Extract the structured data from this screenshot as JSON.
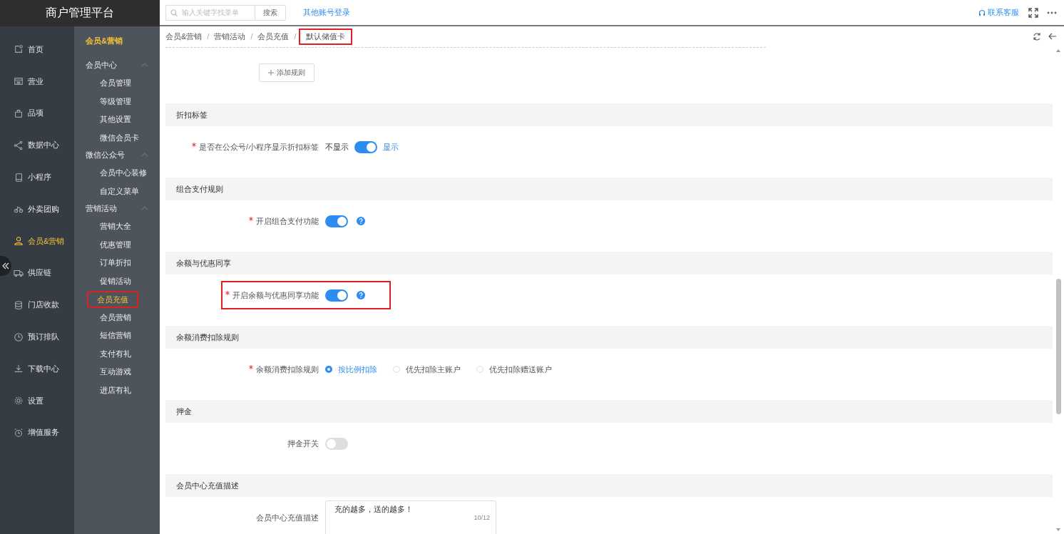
{
  "app_title": "商户管理平台",
  "topbar": {
    "search": {
      "placeholder": "输入关键字找菜单"
    },
    "search_button": "搜索",
    "other_login": "其他账号登录",
    "support": "联系客服"
  },
  "nav": [
    {
      "label": "首页",
      "selected": false
    },
    {
      "label": "营业",
      "selected": false
    },
    {
      "label": "品项",
      "selected": false
    },
    {
      "label": "数据中心",
      "selected": false
    },
    {
      "label": "小程序",
      "selected": false
    },
    {
      "label": "外卖团购",
      "selected": false
    },
    {
      "label": "会员&营销",
      "selected": true
    },
    {
      "label": "供应链",
      "selected": false
    },
    {
      "label": "门店收款",
      "selected": false
    },
    {
      "label": "预订排队",
      "selected": false
    },
    {
      "label": "下载中心",
      "selected": false
    },
    {
      "label": "设置",
      "selected": false
    },
    {
      "label": "增值服务",
      "selected": false
    }
  ],
  "subnav": {
    "title": "会员&营销",
    "groups": [
      {
        "label": "会员中心",
        "expanded": true,
        "items": [
          {
            "label": "会员管理",
            "selected": false,
            "highlighted": false
          },
          {
            "label": "等级管理",
            "selected": false,
            "highlighted": false
          },
          {
            "label": "其他设置",
            "selected": false,
            "highlighted": false
          },
          {
            "label": "微信会员卡",
            "selected": false,
            "highlighted": false
          }
        ]
      },
      {
        "label": "微信公众号",
        "expanded": true,
        "items": [
          {
            "label": "会员中心装修",
            "selected": false,
            "highlighted": false
          },
          {
            "label": "自定义菜单",
            "selected": false,
            "highlighted": false
          }
        ]
      },
      {
        "label": "营销活动",
        "expanded": true,
        "items": [
          {
            "label": "营销大全",
            "selected": false,
            "highlighted": false
          },
          {
            "label": "优惠管理",
            "selected": false,
            "highlighted": false
          },
          {
            "label": "订单折扣",
            "selected": false,
            "highlighted": false
          },
          {
            "label": "促销活动",
            "selected": false,
            "highlighted": false
          },
          {
            "label": "会员充值",
            "selected": true,
            "highlighted": true
          },
          {
            "label": "会员营销",
            "selected": false,
            "highlighted": false
          },
          {
            "label": "短信营销",
            "selected": false,
            "highlighted": false
          },
          {
            "label": "支付有礼",
            "selected": false,
            "highlighted": false
          },
          {
            "label": "互动游戏",
            "selected": false,
            "highlighted": false
          },
          {
            "label": "进店有礼",
            "selected": false,
            "highlighted": false
          }
        ]
      }
    ]
  },
  "breadcrumb_separator": "/",
  "breadcrumb": [
    {
      "label": "会员&营销",
      "highlighted": false
    },
    {
      "label": "营销活动",
      "highlighted": false
    },
    {
      "label": "会员充值",
      "highlighted": false
    },
    {
      "label": "默认储值卡",
      "highlighted": true
    }
  ],
  "add_rule_button": "添加规则",
  "sections": [
    {
      "title": "折扣标签",
      "row": {
        "kind": "toggle_options",
        "label": "是否在公众号/小程序显示折扣标签",
        "required": true,
        "off_text": "不显示",
        "on_text": "显示",
        "on": true,
        "highlighted": false
      }
    },
    {
      "title": "组合支付规则",
      "row": {
        "kind": "toggle",
        "label": "开启组合支付功能",
        "required": true,
        "on": true,
        "help": true,
        "highlighted": false
      }
    },
    {
      "title": "余额与优惠同享",
      "row": {
        "kind": "toggle",
        "label": "开启余额与优惠同享功能",
        "required": true,
        "on": true,
        "help": true,
        "highlighted": true
      }
    },
    {
      "title": "余额消费扣除规则",
      "row": {
        "kind": "radio",
        "label": "余额消费扣除规则",
        "required": true,
        "highlighted": false,
        "options": [
          {
            "label": "按比例扣除",
            "selected": true
          },
          {
            "label": "优先扣除主账户",
            "selected": false
          },
          {
            "label": "优先扣除赠送账户",
            "selected": false
          }
        ]
      }
    },
    {
      "title": "押金",
      "row": {
        "kind": "toggle",
        "label": "押金开关",
        "required": false,
        "on": false,
        "help": false,
        "highlighted": false
      }
    },
    {
      "title": "会员中心充值描述",
      "row": {
        "kind": "textarea",
        "label": "会员中心充值描述",
        "required": false,
        "highlighted": false,
        "value": "充的越多，送的越多！",
        "counter": "10/12"
      }
    }
  ]
}
